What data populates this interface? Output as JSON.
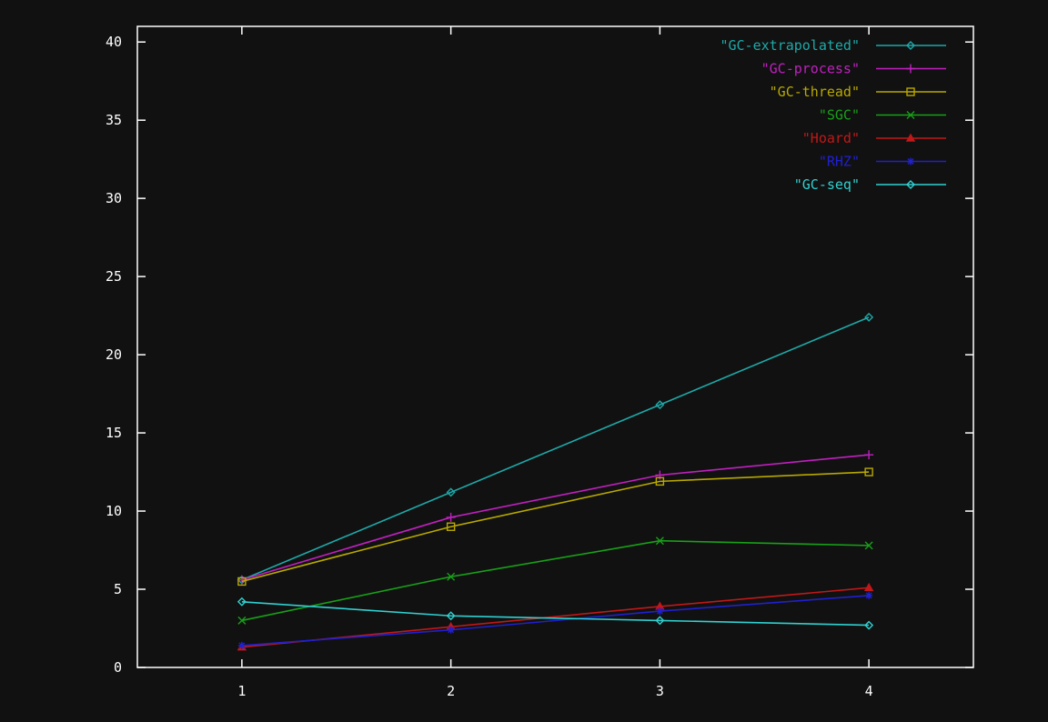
{
  "chart_data": {
    "type": "line",
    "title": "",
    "xlabel": "",
    "ylabel": "",
    "x": [
      1,
      2,
      3,
      4
    ],
    "xticks": [
      "1",
      "2",
      "3",
      "4"
    ],
    "yticks": [
      "0",
      "5",
      "10",
      "15",
      "20",
      "25",
      "30",
      "35",
      "40"
    ],
    "xlim": [
      0.5,
      4.5
    ],
    "ylim": [
      0,
      41
    ],
    "grid": false,
    "legend": "top-right",
    "background": "#111111",
    "axis_color": "#ffffff",
    "series": [
      {
        "name": "\"GC-extrapolated\"",
        "color": "#1fa8a8",
        "marker": "diamond",
        "values": [
          5.6,
          11.2,
          16.8,
          22.4
        ]
      },
      {
        "name": "\"GC-process\"",
        "color": "#c020c0",
        "marker": "plus",
        "values": [
          5.6,
          9.6,
          12.3,
          13.6
        ]
      },
      {
        "name": "\"GC-thread\"",
        "color": "#b8a800",
        "marker": "square",
        "values": [
          5.5,
          9.0,
          11.9,
          12.5
        ]
      },
      {
        "name": "\"SGC\"",
        "color": "#18a018",
        "marker": "cross",
        "values": [
          3.0,
          5.8,
          8.1,
          7.8
        ]
      },
      {
        "name": "\"Hoard\"",
        "color": "#c01818",
        "marker": "triangle",
        "values": [
          1.3,
          2.6,
          3.9,
          5.1
        ]
      },
      {
        "name": "\"RHZ\"",
        "color": "#2020d0",
        "marker": "star",
        "values": [
          1.4,
          2.4,
          3.6,
          4.6
        ]
      },
      {
        "name": "\"GC-seq\"",
        "color": "#30d0d0",
        "marker": "diamond",
        "values": [
          4.2,
          3.3,
          3.0,
          2.7
        ]
      }
    ]
  }
}
